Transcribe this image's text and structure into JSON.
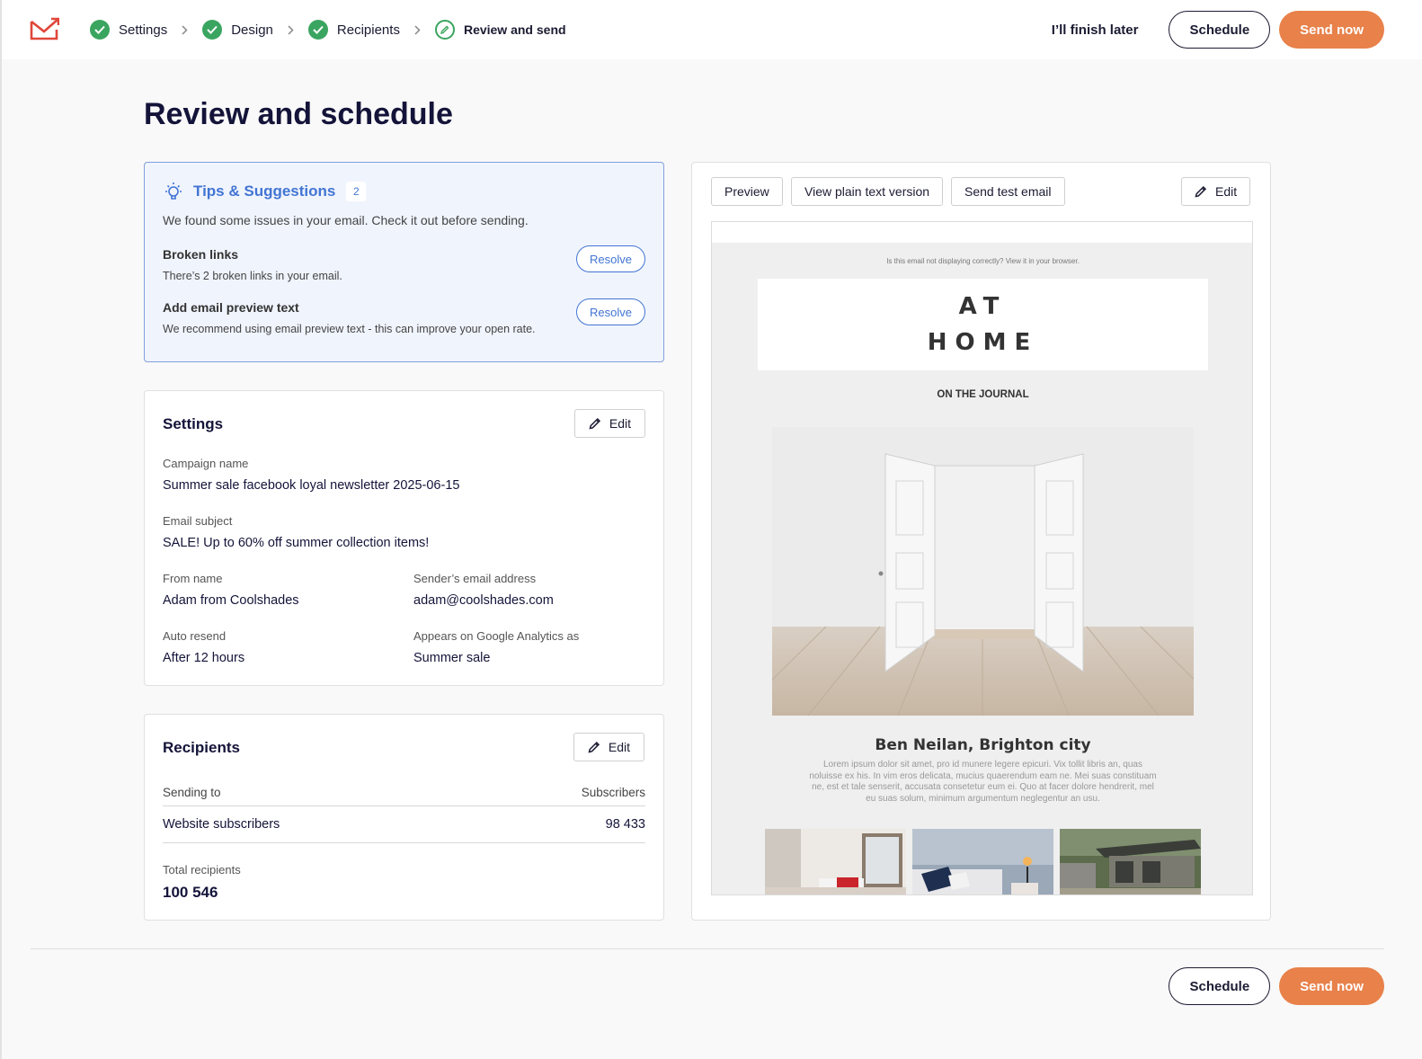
{
  "colors": {
    "accent": "#e8814a",
    "success": "#3aa560",
    "info": "#4275d3",
    "text": "#14143a"
  },
  "steps": [
    {
      "label": "Settings",
      "state": "done"
    },
    {
      "label": "Design",
      "state": "done"
    },
    {
      "label": "Recipients",
      "state": "done"
    },
    {
      "label": "Review and send",
      "state": "current"
    }
  ],
  "header": {
    "finish_later": "I’ll finish later",
    "schedule": "Schedule",
    "send_now": "Send now"
  },
  "page_title": "Review and schedule",
  "tips": {
    "title": "Tips & Suggestions",
    "count": "2",
    "description": "We found some issues in your email. Check it out before sending.",
    "items": [
      {
        "title": "Broken links",
        "text": "There’s 2 broken links in your email.",
        "action": "Resolve"
      },
      {
        "title": "Add email preview text",
        "text": "We recommend using email preview text - this can improve your open rate.",
        "action": "Resolve"
      }
    ]
  },
  "settings": {
    "title": "Settings",
    "edit": "Edit",
    "campaign_name_label": "Campaign name",
    "campaign_name": "Summer sale facebook loyal newsletter 2025-06-15",
    "subject_label": "Email subject",
    "subject": "SALE! Up to 60% off summer collection items!",
    "from_name_label": "From name",
    "from_name": "Adam from Coolshades",
    "sender_email_label": "Sender’s email address",
    "sender_email": "adam@coolshades.com",
    "auto_resend_label": "Auto resend",
    "auto_resend": "After 12 hours",
    "ga_label": "Appears on Google Analytics as",
    "ga_value": "Summer sale"
  },
  "recipients": {
    "title": "Recipients",
    "edit": "Edit",
    "col_sending_to": "Sending to",
    "col_subscribers": "Subscribers",
    "rows": [
      {
        "name": "Website subscribers",
        "count": "98 433"
      }
    ],
    "total_label": "Total recipients",
    "total_value": "100 546"
  },
  "preview": {
    "preview_btn": "Preview",
    "plain_text_btn": "View plain text version",
    "test_email_btn": "Send test email",
    "edit_btn": "Edit",
    "email": {
      "notice": "Is this email not displaying correctly? View it in your browser.",
      "brand_line1": "AT",
      "brand_line2": "HOME",
      "section": "ON THE JOURNAL",
      "author": "Ben Neilan, Brighton city",
      "body": "Lorem ipsum dolor sit amet, pro id munere legere epicuri. Vix tollit libris an, quas noluisse ex his. In vim eros delicata, mucius quaerendum eam ne. Mei suas constituam ne, est et tale senserit, accusata consetetur eum ei. Quo at facer dolore hendrerit, mel eu suas solum, minimum argumentum neglegentur an usu."
    }
  },
  "footer": {
    "schedule": "Schedule",
    "send_now": "Send now"
  }
}
